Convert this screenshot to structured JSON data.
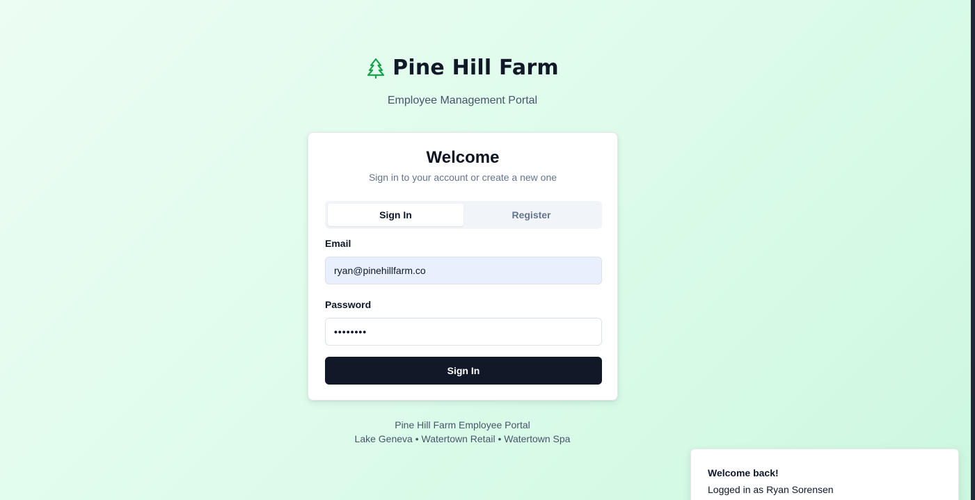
{
  "brand": {
    "title": "Pine Hill Farm",
    "logo_icon": "pine-tree-icon",
    "subtitle": "Employee Management Portal",
    "accent_color": "#16a34a"
  },
  "auth_card": {
    "title": "Welcome",
    "subtitle": "Sign in to your account or create a new one",
    "tabs": [
      {
        "label": "Sign In",
        "active": true
      },
      {
        "label": "Register",
        "active": false
      }
    ],
    "email": {
      "label": "Email",
      "value": "ryan@pinehillfarm.co"
    },
    "password": {
      "label": "Password",
      "value": "••••••••"
    },
    "submit_label": "Sign In",
    "button_color": "#111827"
  },
  "footer": {
    "line1": "Pine Hill Farm Employee Portal",
    "line2": "Lake Geneva • Watertown Retail • Watertown Spa"
  },
  "toast": {
    "title": "Welcome back!",
    "description": "Logged in as Ryan Sorensen"
  }
}
